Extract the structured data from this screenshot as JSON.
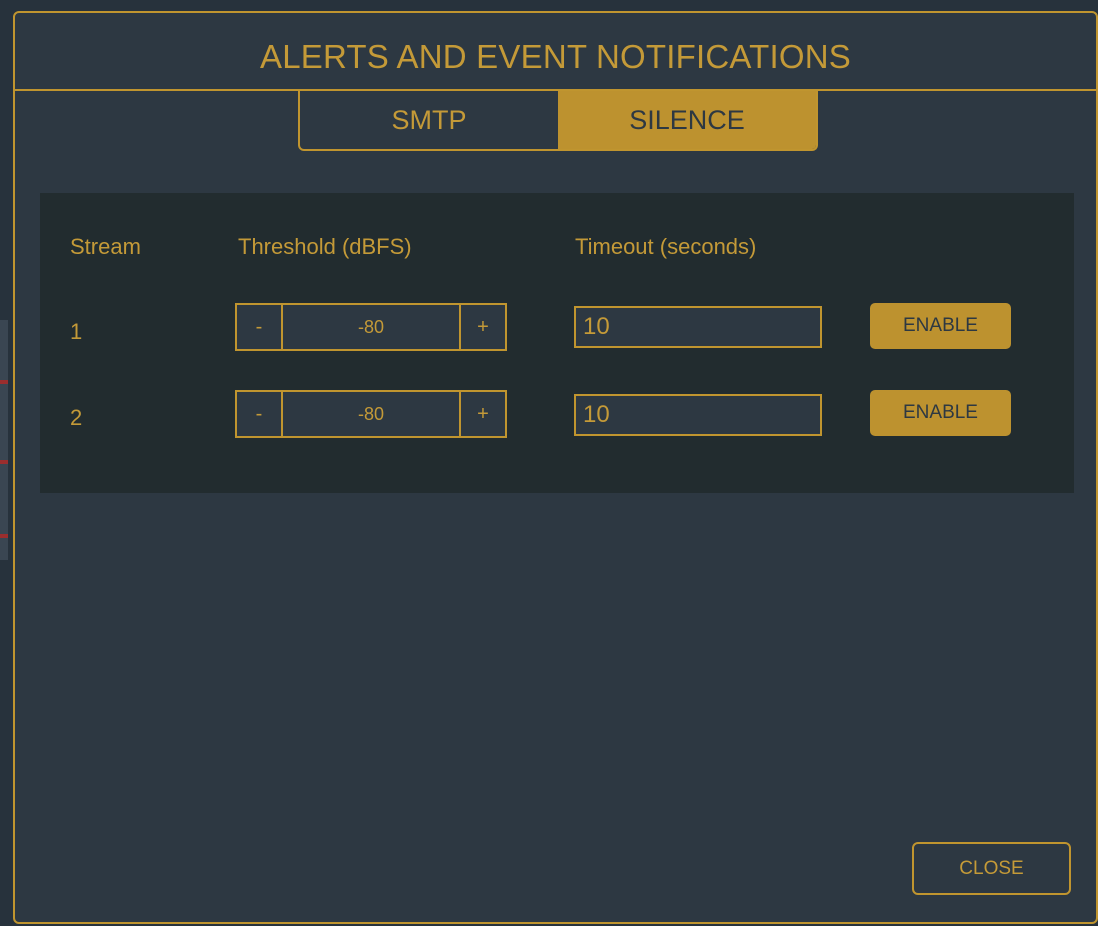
{
  "dialog": {
    "title": "ALERTS AND EVENT NOTIFICATIONS",
    "close_label": "CLOSE"
  },
  "tabs": [
    {
      "label": "SMTP",
      "active": false
    },
    {
      "label": "SILENCE",
      "active": true
    }
  ],
  "table": {
    "headers": {
      "stream": "Stream",
      "threshold": "Threshold (dBFS)",
      "timeout": "Timeout (seconds)"
    },
    "rows": [
      {
        "stream": "1",
        "threshold": "-80",
        "timeout": "10",
        "action": "ENABLE"
      },
      {
        "stream": "2",
        "threshold": "-80",
        "timeout": "10",
        "action": "ENABLE"
      }
    ],
    "decrement_label": "-",
    "increment_label": "+"
  },
  "colors": {
    "accent": "#c0952f",
    "background": "#2d3842",
    "panel": "#222c2f"
  }
}
